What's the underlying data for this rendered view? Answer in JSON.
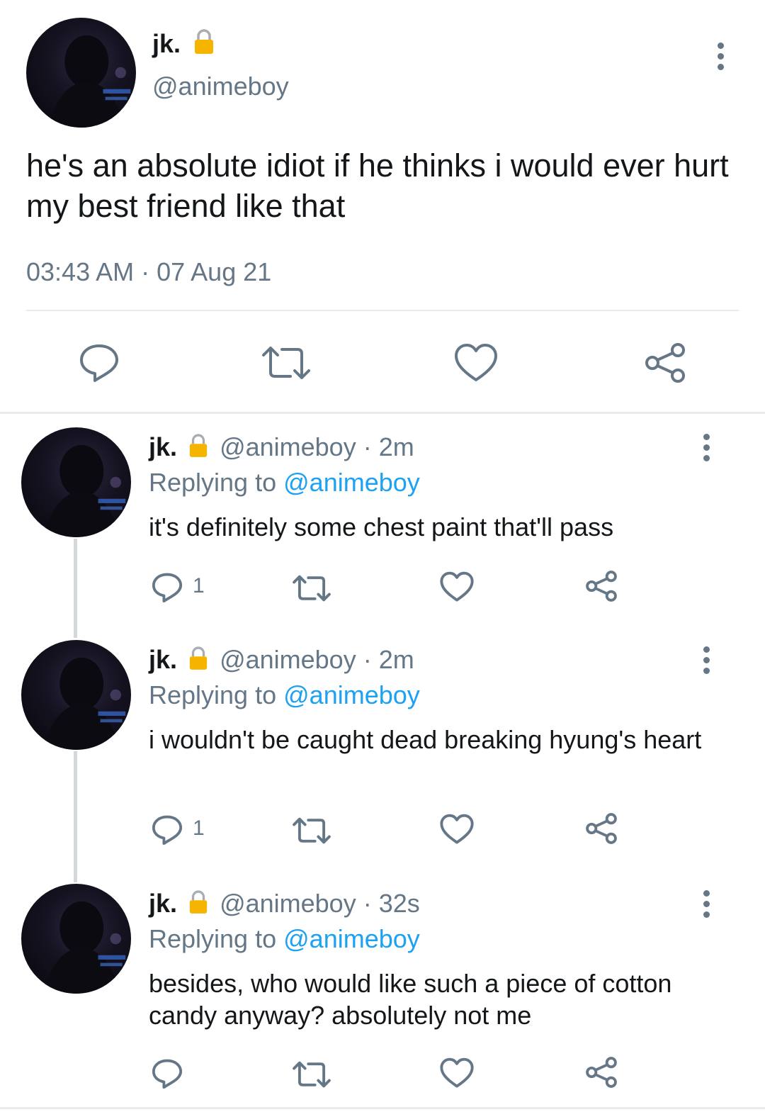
{
  "main_tweet": {
    "name": "jk.",
    "handle": "@animeboy",
    "text": "he's an absolute idiot if he thinks i would ever hurt my best friend like that",
    "timestamp": "03:43 AM · 07 Aug 21",
    "actions": [
      "reply-icon",
      "retweet-icon",
      "like-icon",
      "share-icon"
    ]
  },
  "replies": [
    {
      "name": "jk.",
      "handle": "@animeboy",
      "time": "· 2m",
      "replying_label": "Replying to",
      "replying_to": "@animeboy",
      "text": "it's definitely some chest paint that'll pass",
      "reply_count": "1"
    },
    {
      "name": "jk.",
      "handle": "@animeboy",
      "time": "· 2m",
      "replying_label": "Replying to",
      "replying_to": "@animeboy",
      "text": "i wouldn't be caught dead breaking hyung's heart",
      "reply_count": "1"
    },
    {
      "name": "jk.",
      "handle": "@animeboy",
      "time": "· 32s",
      "replying_label": "Replying to",
      "replying_to": "@animeboy",
      "text": "besides, who would like such a piece of cotton candy anyway? absolutely not me",
      "reply_count": ""
    }
  ],
  "colors": {
    "text": "#14171a",
    "muted": "#657786",
    "link": "#1da1f2",
    "divider": "#e6ecf0",
    "lock": "#f4b400"
  }
}
